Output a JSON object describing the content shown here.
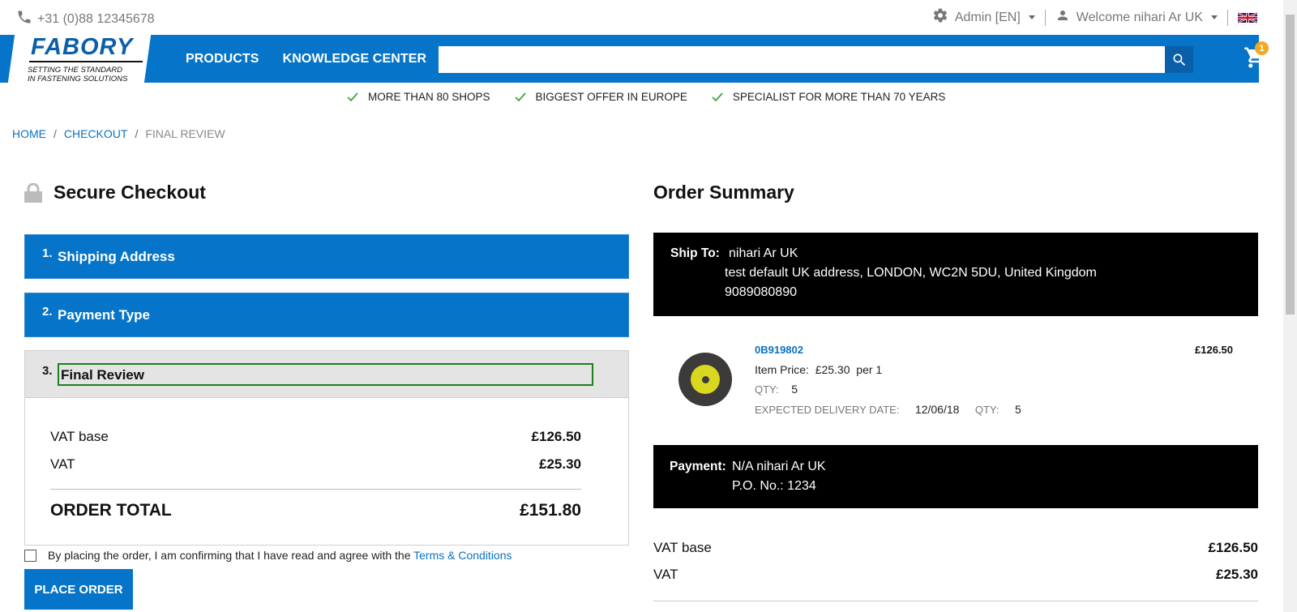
{
  "topbar": {
    "phone": "+31 (0)88 12345678",
    "admin_label": "Admin [EN]",
    "welcome_label": "Welcome nihari Ar UK"
  },
  "nav": {
    "logo_word": "FABORY",
    "logo_tag_line1": "SETTING THE STANDARD",
    "logo_tag_line2": "IN FASTENING SOLUTIONS",
    "products": "PRODUCTS",
    "knowledge_center": "KNOWLEDGE CENTER",
    "search_placeholder": "",
    "cart_count": "1"
  },
  "value_props": [
    "MORE THAN 80 SHOPS",
    "BIGGEST OFFER IN EUROPE",
    "SPECIALIST FOR MORE THAN 70 YEARS"
  ],
  "breadcrumb": {
    "home": "HOME",
    "checkout": "CHECKOUT",
    "current": "FINAL REVIEW",
    "sep": "/"
  },
  "checkout": {
    "title": "Secure Checkout",
    "steps": [
      {
        "num": "1.",
        "label": "Shipping Address"
      },
      {
        "num": "2.",
        "label": "Payment Type"
      },
      {
        "num": "3.",
        "label": "Final Review"
      }
    ],
    "vat_base_label": "VAT base",
    "vat_base_value": "£126.50",
    "vat_label": "VAT",
    "vat_value": "£25.30",
    "total_label": "ORDER TOTAL",
    "total_value": "£151.80",
    "terms_text": "By placing the order, I am confirming that I have read and agree with the",
    "terms_link": "Terms & Conditions",
    "place_order": "PLACE ORDER"
  },
  "summary": {
    "title": "Order Summary",
    "ship_to_label": "Ship To:",
    "ship_name": "nihari Ar UK",
    "ship_address": "test default UK address,  LONDON,  WC2N 5DU,  United Kingdom",
    "ship_phone": "9089080890",
    "item": {
      "sku": "0B919802",
      "price": "£126.50",
      "item_price_label": "Item Price:",
      "item_price_value": "£25.30",
      "item_price_unit": "per 1",
      "qty_label": "QTY:",
      "qty_value": "5",
      "delivery_label": "EXPECTED DELIVERY DATE:",
      "delivery_value": "12/06/18",
      "delivery_qty_label": "QTY:",
      "delivery_qty_value": "5"
    },
    "payment_label": "Payment:",
    "payment_line1": "N/A nihari Ar UK",
    "payment_line2": "P.O. No.: 1234",
    "vat_base_label": "VAT base",
    "vat_base_value": "£126.50",
    "vat_label": "VAT",
    "vat_value": "£25.30"
  },
  "colors": {
    "brand_blue": "#0675c9",
    "link_blue": "#0b72c2",
    "badge_orange": "#f5a623",
    "check_green": "#3aa53a",
    "focus_green": "#1d7f1d"
  },
  "icons": [
    "phone-icon",
    "gear-icon",
    "user-icon",
    "uk-flag-icon",
    "search-icon",
    "cart-icon",
    "check-icon",
    "lock-icon"
  ]
}
